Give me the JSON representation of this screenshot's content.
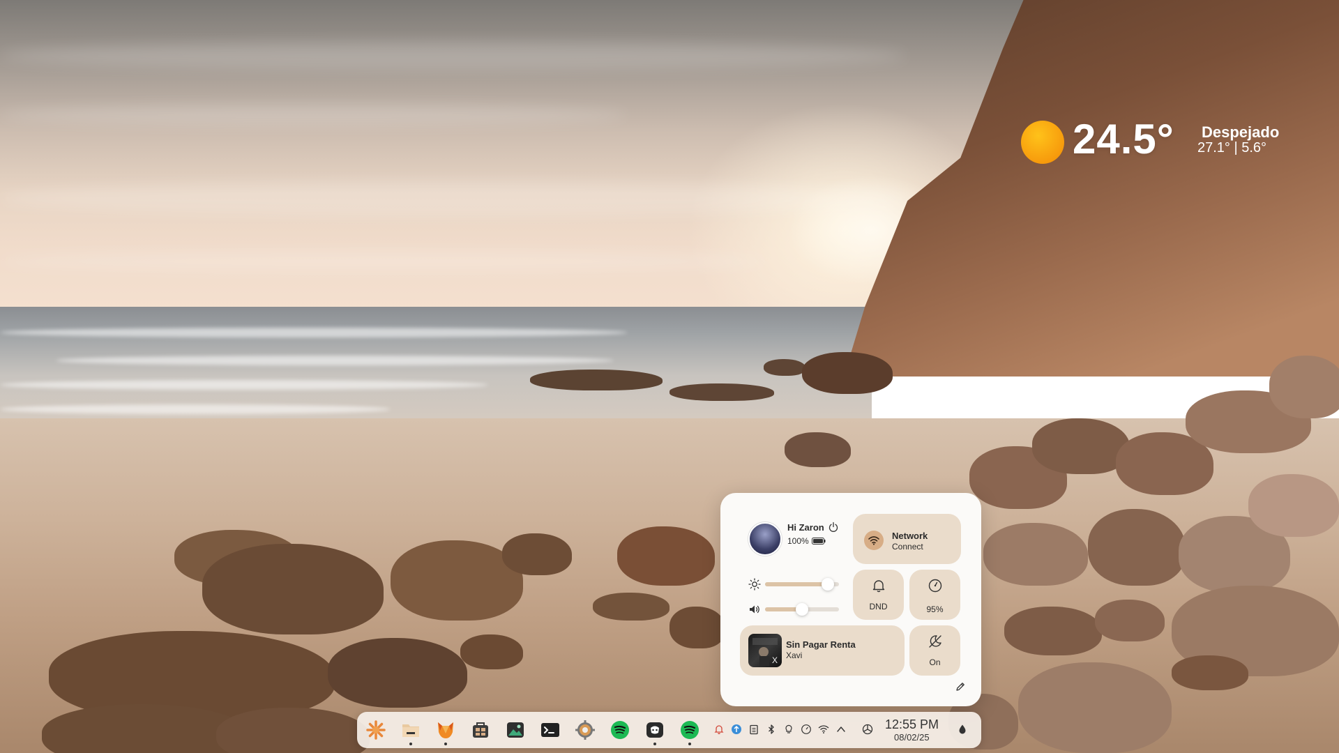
{
  "weather": {
    "temperature": "24.5°",
    "condition": "Despejado",
    "range": "27.1° | 5.6°",
    "icon": "sun-icon"
  },
  "control_center": {
    "user": {
      "greeting": "Hi Zaron",
      "battery": "100%",
      "icons": [
        "avatar",
        "power-icon",
        "battery-icon"
      ]
    },
    "network": {
      "title": "Network",
      "subtitle": "Connect",
      "icon": "wifi-icon"
    },
    "brightness": {
      "icon": "brightness-icon",
      "level": 0.85
    },
    "volume": {
      "icon": "volume-icon",
      "level": 0.5
    },
    "dnd": {
      "label": "DND",
      "icon": "bell-icon"
    },
    "performance": {
      "label": "95%",
      "icon": "gauge-icon"
    },
    "media": {
      "title": "Sin Pagar Renta",
      "artist": "Xavi",
      "icon": "album-art"
    },
    "night_light": {
      "label": "On",
      "icon": "night-light-icon"
    },
    "edit": {
      "icon": "pencil-icon"
    }
  },
  "taskbar": {
    "apps": [
      {
        "name": "launcher",
        "icon": "launcher-icon"
      },
      {
        "name": "files",
        "icon": "folder-icon"
      },
      {
        "name": "firefox",
        "icon": "firefox-icon"
      },
      {
        "name": "store",
        "icon": "store-icon"
      },
      {
        "name": "image-viewer",
        "icon": "image-icon"
      },
      {
        "name": "terminal",
        "icon": "terminal-icon"
      },
      {
        "name": "settings",
        "icon": "settings-icon"
      },
      {
        "name": "spotify",
        "icon": "spotify-icon"
      },
      {
        "name": "chat",
        "icon": "chat-icon"
      },
      {
        "name": "spotify",
        "icon": "spotify-icon"
      }
    ],
    "tray": [
      "notification-icon",
      "update-icon",
      "clipboard-icon",
      "bluetooth-icon",
      "lightbulb-icon",
      "power-profile-icon",
      "wifi-icon",
      "chevron-up-icon",
      "settings-cog-icon",
      "dropper-icon"
    ],
    "clock": {
      "time": "12:55 PM",
      "date": "08/02/25"
    },
    "colors": {
      "accent": "#d7ad86",
      "tile": "#eadccb",
      "panel": "#fbfaf8"
    }
  }
}
